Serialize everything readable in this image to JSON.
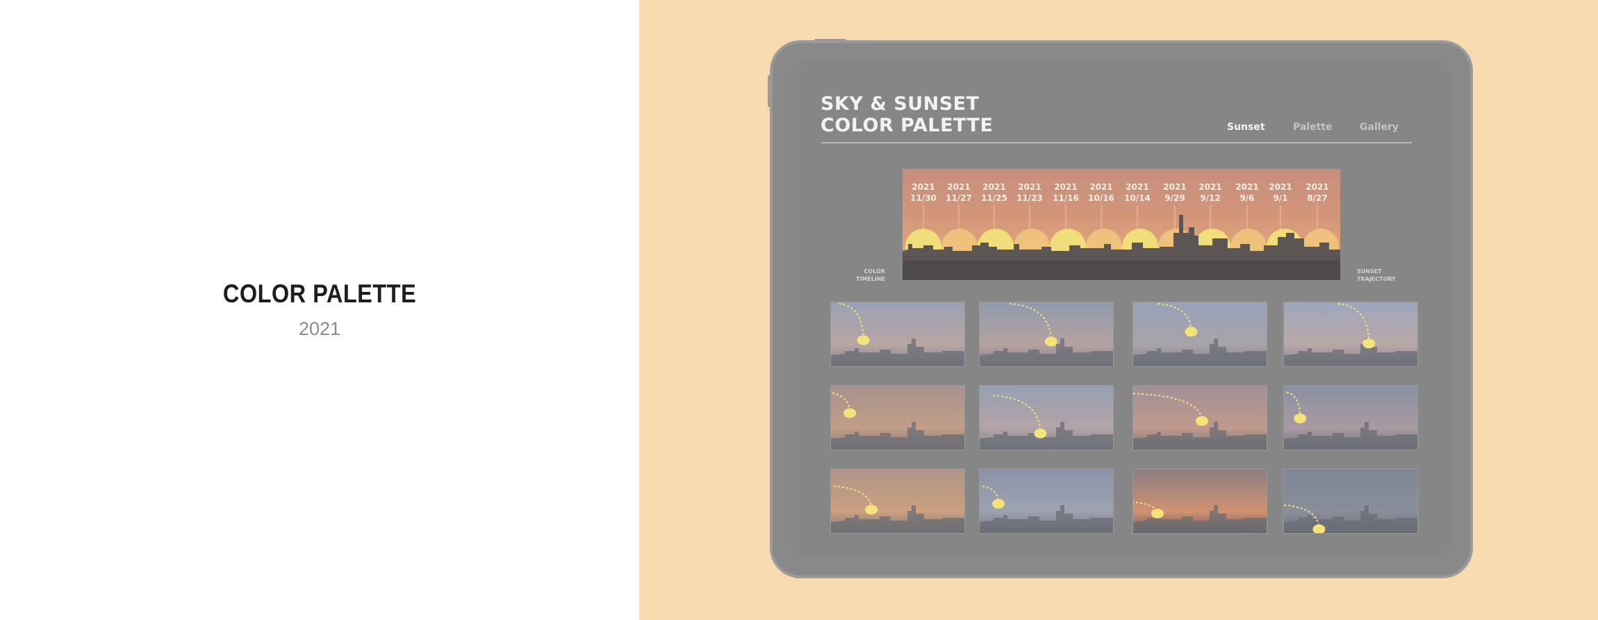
{
  "cover": {
    "title": "COLOR PALETTE",
    "year": "2021"
  },
  "app": {
    "title_line1": "SKY & SUNSET",
    "title_line2": "COLOR PALETTE",
    "nav": {
      "sunset": "Sunset",
      "palette": "Palette",
      "gallery": "Gallery",
      "active": "Sunset"
    },
    "timeline": {
      "dates": [
        {
          "year": "2021",
          "day": "11/30"
        },
        {
          "year": "2021",
          "day": "11/27"
        },
        {
          "year": "2021",
          "day": "11/25"
        },
        {
          "year": "2021",
          "day": "11/23"
        },
        {
          "year": "2021",
          "day": "11/16"
        },
        {
          "year": "2021",
          "day": "10/16"
        },
        {
          "year": "2021",
          "day": "10/14"
        },
        {
          "year": "2021",
          "day": "9/29"
        },
        {
          "year": "2021",
          "day": "9/12"
        },
        {
          "year": "2021",
          "day": "9/6"
        },
        {
          "year": "2021",
          "day": "9/1"
        },
        {
          "year": "2021",
          "day": "8/27"
        }
      ],
      "left_label_line1": "COLOR",
      "left_label_line2": "TIMELINE",
      "right_label_line1": "SUNSET",
      "right_label_line2": "TRAJECTORY"
    },
    "gallery": {
      "rows": 3,
      "columns": 4,
      "count": 12
    }
  },
  "colors": {
    "left_background": "#ffffff",
    "right_background": "#f7dab0",
    "tablet_body": "#898989",
    "sun_yellow": "#f3e37a",
    "sky_peach": "#e0a37a"
  },
  "icons": [
    "sun-icon",
    "skyline-silhouette",
    "trajectory-dashed-path"
  ]
}
